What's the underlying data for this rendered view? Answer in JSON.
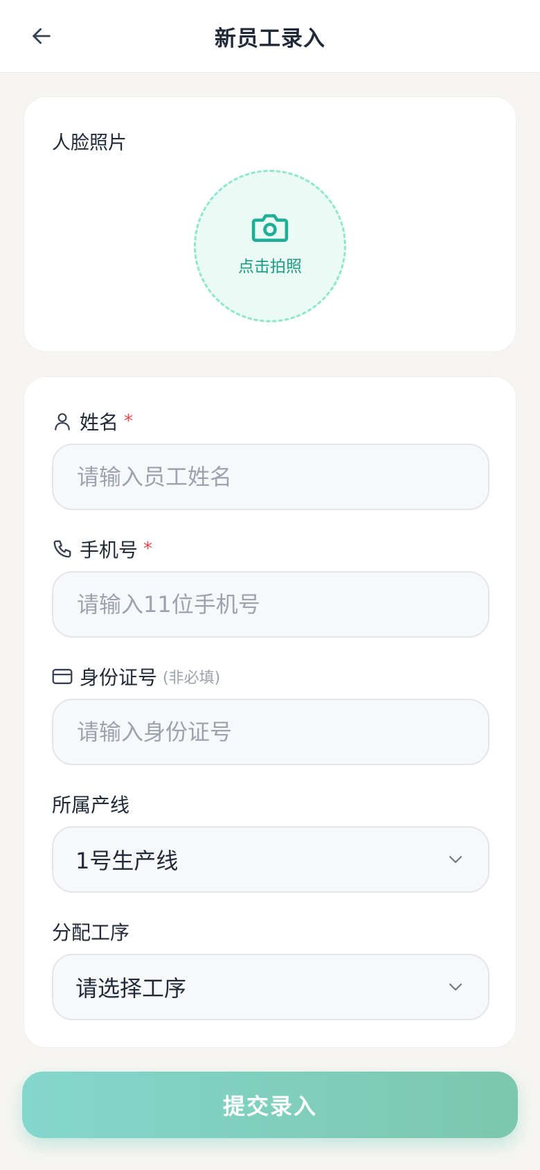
{
  "header": {
    "title": "新员工录入",
    "back_icon": "arrow-left-icon"
  },
  "photo": {
    "label": "人脸照片",
    "button_text": "点击拍照",
    "icon": "camera-icon",
    "accent": "#1d9a86"
  },
  "form": {
    "name": {
      "label": "姓名",
      "required": "*",
      "placeholder": "请输入员工姓名",
      "icon": "user-icon"
    },
    "phone": {
      "label": "手机号",
      "required": "*",
      "placeholder": "请输入11位手机号",
      "icon": "phone-icon"
    },
    "id_card": {
      "label": "身份证号",
      "optional": "(非必填)",
      "placeholder": "请输入身份证号",
      "icon": "id-card-icon"
    },
    "line": {
      "label": "所属产线",
      "value": "1号生产线",
      "icon": "chevron-down-icon"
    },
    "process": {
      "label": "分配工序",
      "value": "请选择工序",
      "icon": "chevron-down-icon"
    }
  },
  "submit": {
    "label": "提交录入"
  }
}
